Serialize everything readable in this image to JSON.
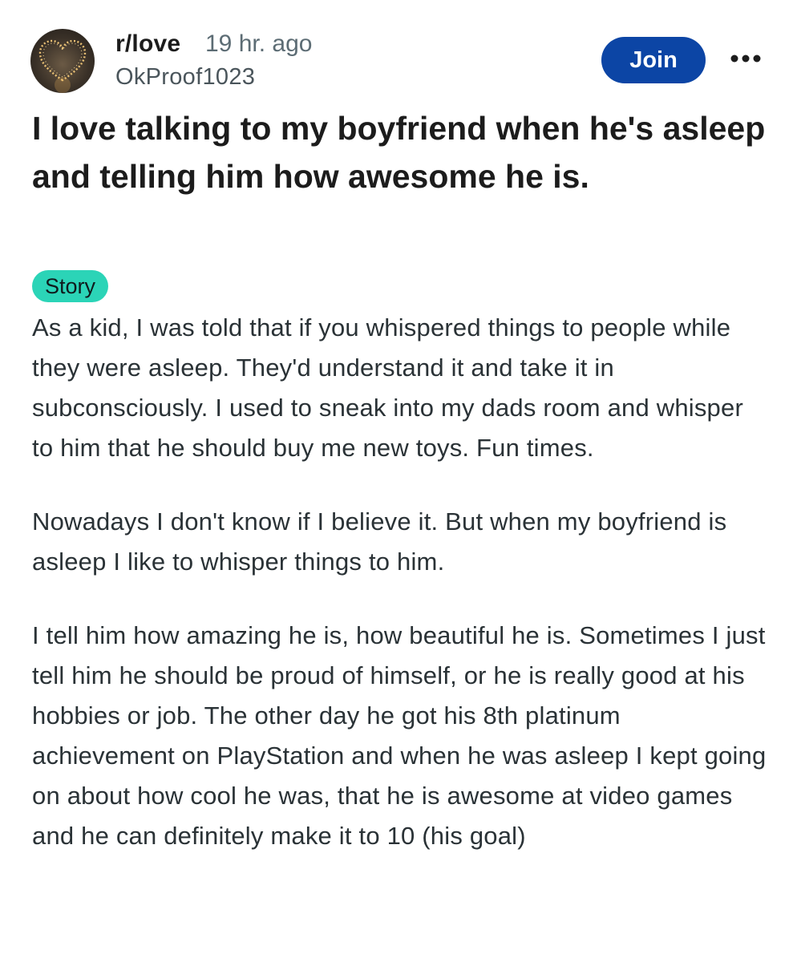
{
  "post": {
    "subreddit": "r/love",
    "time_ago": "19 hr. ago",
    "author": "OkProof1023",
    "join_label": "Join",
    "more_label": "•••",
    "title": "I love talking to my boyfriend when he's asleep and telling him how awesome he is.",
    "flair": "Story",
    "paragraphs": [
      "As a kid, I was told that if you whispered things to people while they were asleep. They'd understand it and take it in subconsciously. I used to sneak into my dads room and whisper to him that he should buy me new toys. Fun times.",
      "Nowadays I don't know if I believe it. But when my boyfriend is asleep I like to whisper things to him.",
      "I tell him how amazing he is, how beautiful he is. Sometimes I just tell him he should be proud of himself, or he is really good at his hobbies or job. The other day he got his 8th platinum achievement on PlayStation and when he was asleep I kept going on about how cool he was, that he is awesome at video games and he can definitely make it to 10 (his goal)"
    ]
  },
  "colors": {
    "join_button": "#0c45a5",
    "flair": "#2bd4b7",
    "meta_text": "#5c6c74"
  },
  "icons": {
    "avatar": "heart-lights-avatar",
    "more": "more-options-icon"
  }
}
